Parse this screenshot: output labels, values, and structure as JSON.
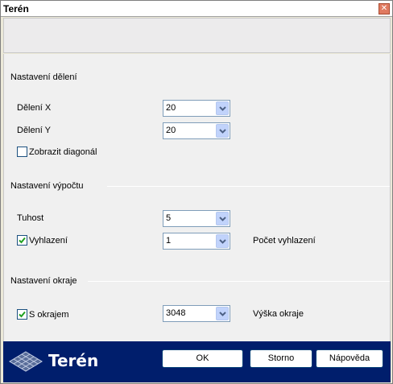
{
  "window": {
    "title": "Terén",
    "close_icon": "close-icon"
  },
  "sections": {
    "division": {
      "label": "Nastavení dělení"
    },
    "calculation": {
      "label": "Nastavení výpočtu"
    },
    "edge": {
      "label": "Nastavení okraje"
    }
  },
  "fields": {
    "division_x": {
      "label": "Dělení X",
      "value": "20"
    },
    "division_y": {
      "label": "Dělení Y",
      "value": "20"
    },
    "show_diagonal": {
      "label": "Zobrazit diagonál",
      "checked": false
    },
    "stiffness": {
      "label": "Tuhost",
      "value": "5"
    },
    "smoothing": {
      "label": "Vyhlazení",
      "checked": true,
      "value": "1",
      "side_label": "Počet vyhlazení"
    },
    "with_edge": {
      "label": "S okrajem",
      "checked": true,
      "value": "3048",
      "side_label": "Výška okraje"
    }
  },
  "footer": {
    "logo_text": "Terén",
    "logo_icon": "terrain-grid-icon",
    "ok_label": "OK",
    "cancel_label": "Storno",
    "help_label": "Nápověda"
  },
  "colors": {
    "footer_bg": "#001e6c",
    "combo_arrow": "#c1d3fb",
    "checkbox_border": "#1c5180"
  }
}
